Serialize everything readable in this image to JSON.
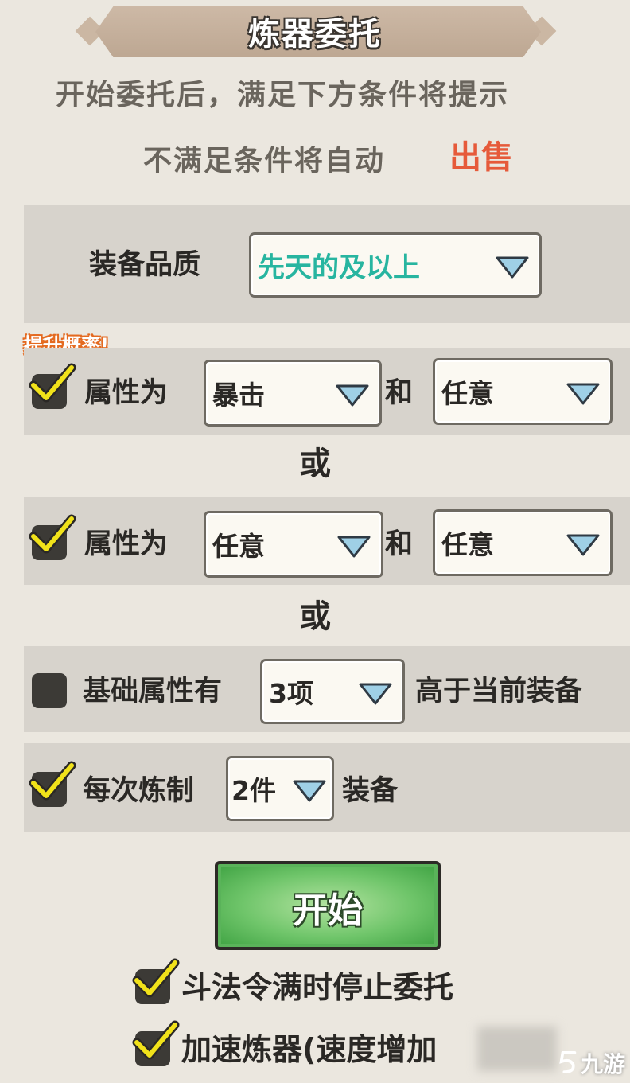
{
  "header": {
    "title": "炼器委托"
  },
  "info": {
    "line1": "开始委托后，满足下方条件将提示",
    "line2": "不满足条件将自动",
    "sell": "出售"
  },
  "quality": {
    "label": "装备品质",
    "value": "先天的及以上"
  },
  "hint": "提升概率!",
  "rule1": {
    "checked": true,
    "label": "属性为",
    "attr1": "暴击",
    "and": "和",
    "attr2": "任意"
  },
  "or1": "或",
  "rule2": {
    "checked": true,
    "label": "属性为",
    "attr1": "任意",
    "and": "和",
    "attr2": "任意"
  },
  "or2": "或",
  "rule3": {
    "checked": false,
    "label": "基础属性有",
    "count": "3项",
    "suffix": "高于当前装备"
  },
  "rule4": {
    "checked": true,
    "label": "每次炼制",
    "count": "2件",
    "suffix": "装备"
  },
  "start_button": "开始",
  "option1": {
    "checked": true,
    "label": "斗法令满时停止委托"
  },
  "option2": {
    "checked": true,
    "label": "加速炼器(速度增加"
  },
  "watermark": "九游",
  "colors": {
    "sell": "#e65a3a",
    "quality": "#27b5a0",
    "start": "#6fc56a",
    "check": "#f1e21a"
  }
}
